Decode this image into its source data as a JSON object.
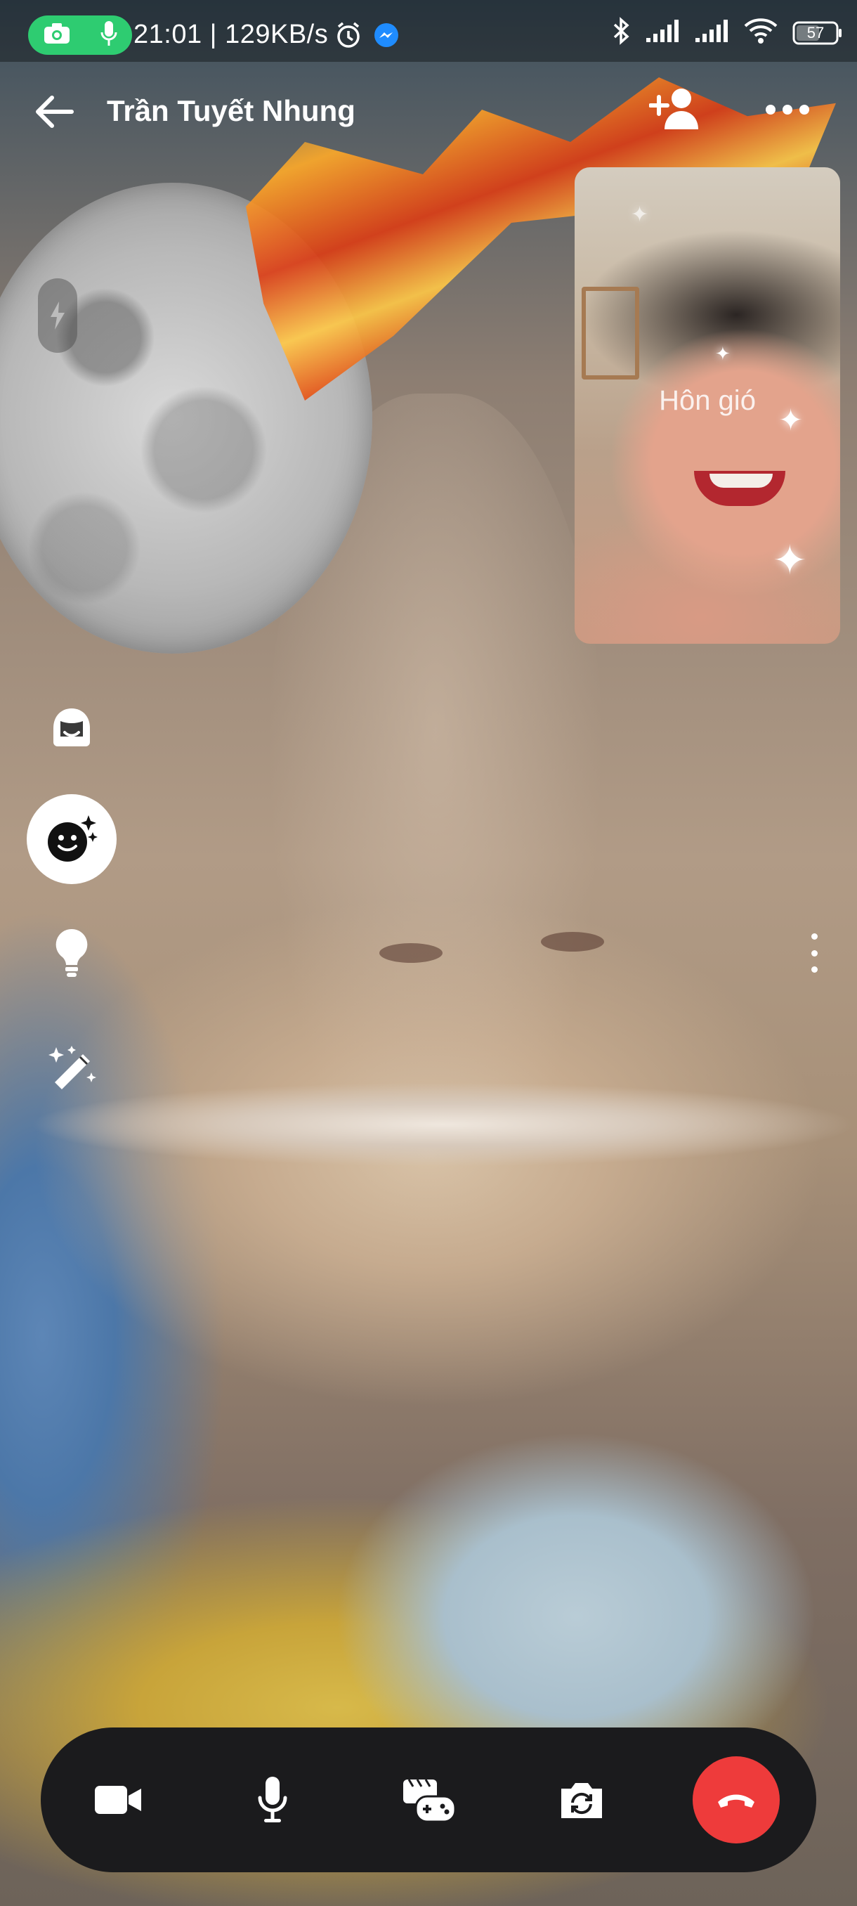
{
  "status_bar": {
    "time_speed": "21:01 | 129KB/s",
    "battery": "57",
    "icons": [
      "camera-icon",
      "microphone-icon",
      "alarm-icon",
      "messenger-icon",
      "bluetooth-icon",
      "signal-icon",
      "signal-icon",
      "wifi-icon",
      "battery-icon"
    ],
    "pill_color": "#2ecc71"
  },
  "header": {
    "contact_name": "Trần Tuyết Nhung",
    "actions": [
      "back-arrow-icon",
      "add-person-icon",
      "more-icon"
    ]
  },
  "pip": {
    "effect_label": "Hôn gió"
  },
  "left_tools": [
    "flash-icon",
    "avatar-icon",
    "face-effects-icon",
    "lightbulb-icon",
    "magic-wand-icon"
  ],
  "controls": {
    "buttons": [
      "video-camera-icon",
      "microphone-icon",
      "games-icon",
      "flip-camera-icon",
      "end-call-icon"
    ],
    "end_call_color": "#ee3b3b"
  }
}
